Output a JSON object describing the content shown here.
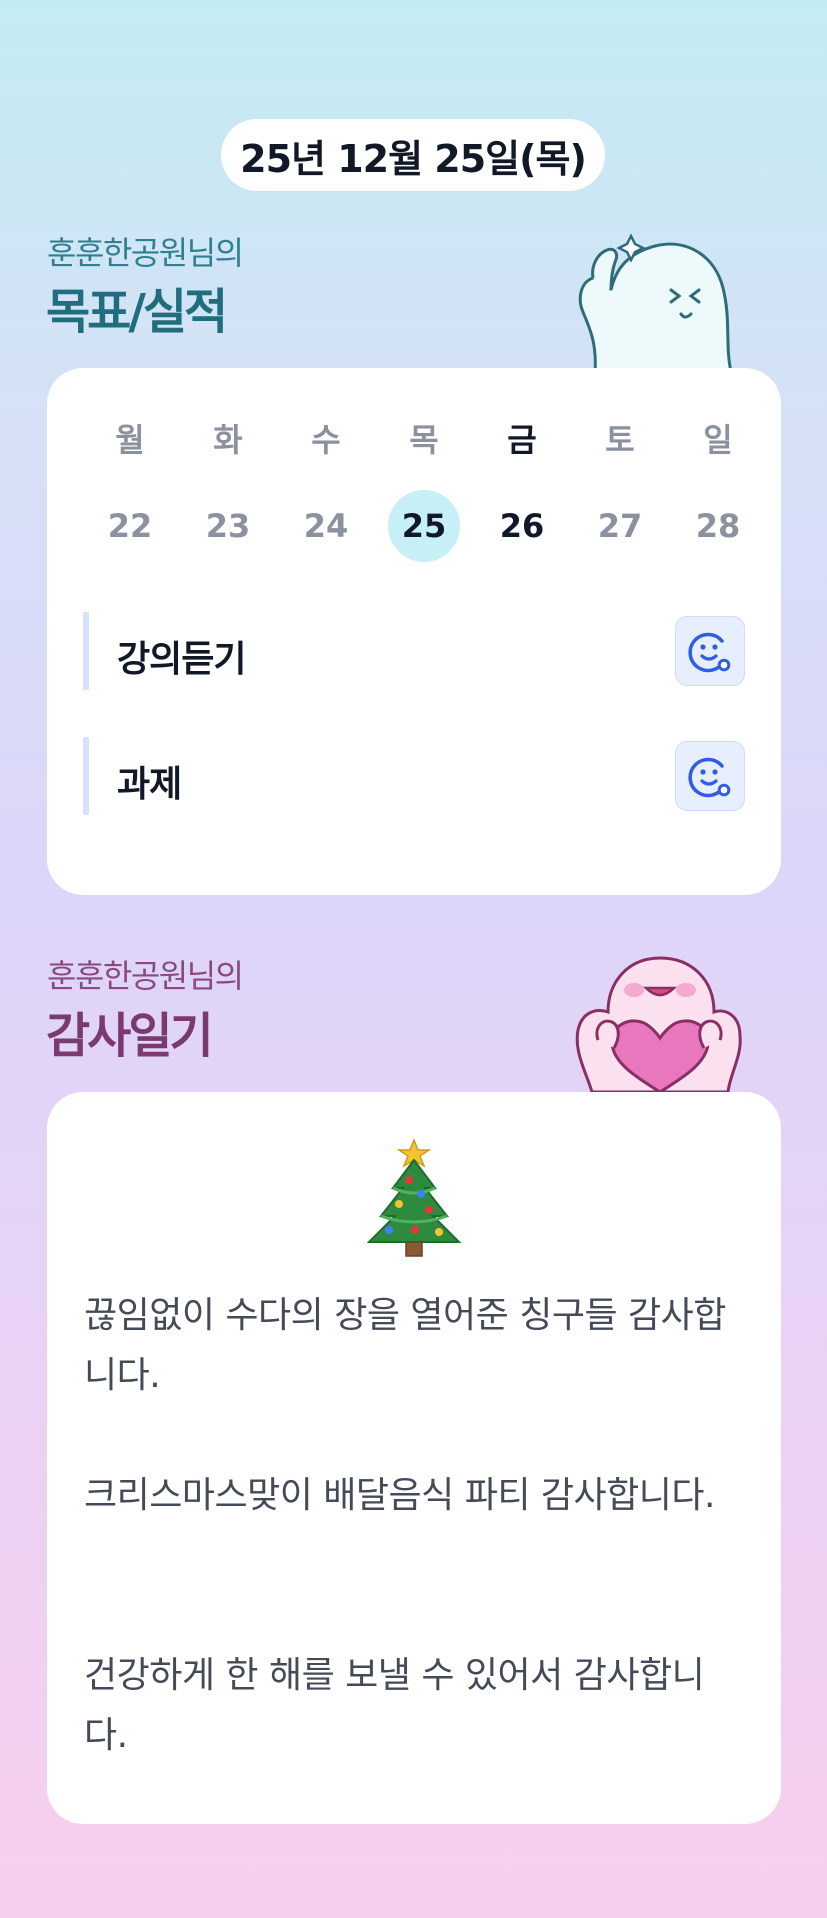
{
  "date_label": "25년 12월 25일(목)",
  "goal_section": {
    "subtitle": "훈훈한공원님의",
    "title": "목표/실적",
    "weekdays": [
      "월",
      "화",
      "수",
      "목",
      "금",
      "토",
      "일"
    ],
    "days": [
      "22",
      "23",
      "24",
      "25",
      "26",
      "27",
      "28"
    ],
    "selected_day": "25",
    "goals": [
      {
        "label": "강의듣기"
      },
      {
        "label": "과제"
      }
    ]
  },
  "diary_section": {
    "subtitle": "훈훈한공원님의",
    "title": "감사일기",
    "emoji": "christmas-tree-icon",
    "entries": [
      "끊임없이 수다의 장을 열어준 칭구들 감사합니다.",
      "크리스마스맞이 배달음식 파티 감사합니다.",
      "건강하게 한 해를 보낼 수 있어서 감사합니다."
    ]
  },
  "colors": {
    "goal_title": "#1f6d7d",
    "diary_title": "#7a3a6f",
    "selected_day_bg": "#c6eff6",
    "face_icon": "#2f5de6"
  }
}
